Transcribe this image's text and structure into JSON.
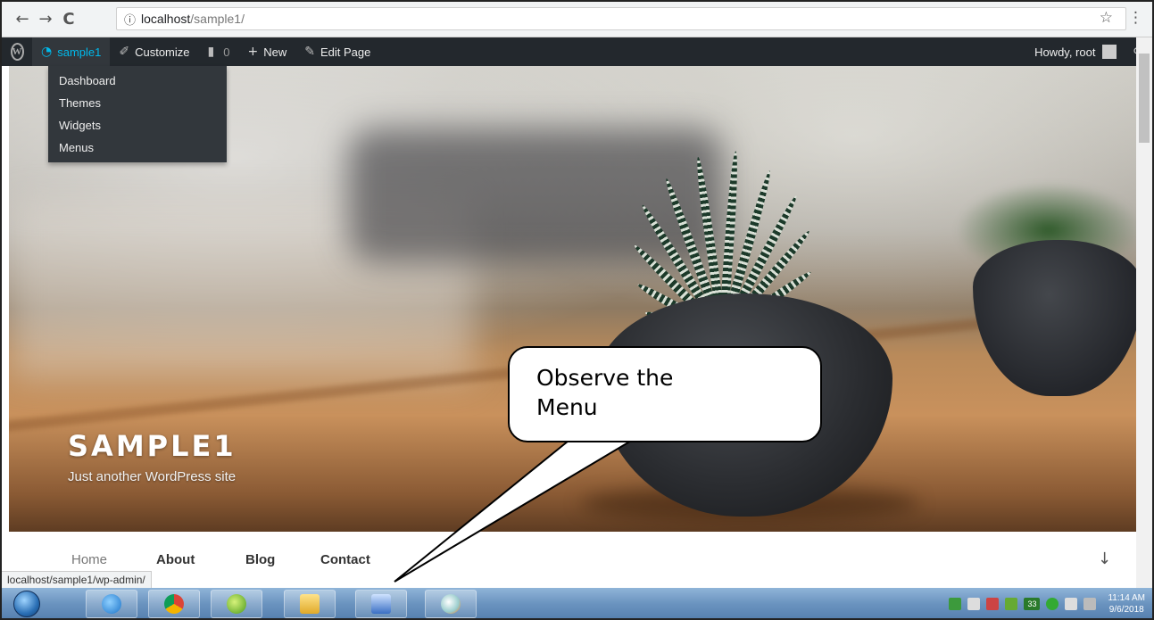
{
  "browser": {
    "back_icon": "←",
    "forward_icon": "→",
    "reload_icon": "C",
    "info_icon": "ⓘ",
    "url_host": "localhost",
    "url_path": "/sample1/",
    "star_icon": "☆",
    "menu_icon": "⋮"
  },
  "adminbar": {
    "wp_logo": "W",
    "site_name": "sample1",
    "customize": "Customize",
    "comments_count": "0",
    "new": "New",
    "edit_page": "Edit Page",
    "howdy": "Howdy, root",
    "search_icon": "⚲"
  },
  "dropdown": {
    "items": [
      "Dashboard",
      "Themes",
      "Widgets",
      "Menus"
    ]
  },
  "hero": {
    "title": "SAMPLE1",
    "description": "Just another WordPress site"
  },
  "callout": {
    "line1": "Observe the",
    "line2": "Menu"
  },
  "site_nav": {
    "items": [
      "Home",
      "About",
      "Blog",
      "Contact"
    ],
    "scroll_icon": "↓"
  },
  "status_bar": {
    "url": "localhost/sample1/wp-admin/"
  },
  "taskbar": {
    "time": "11:14 AM",
    "date": "9/6/2018",
    "tray_badge": "33"
  }
}
